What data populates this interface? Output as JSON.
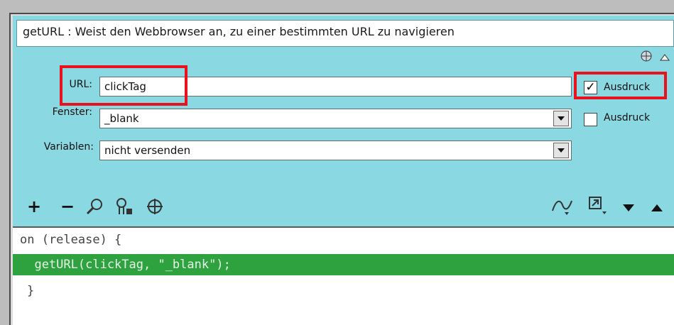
{
  "title": "getURL : Weist den Webbrowser an, zu einer bestimmten URL zu navigieren",
  "top_icons": [
    "globe-icon",
    "collapse-up-icon"
  ],
  "fields": {
    "url": {
      "label": "URL:",
      "value": "clickTag",
      "checkbox_checked": true,
      "checkbox_label": "Ausdruck"
    },
    "fenster": {
      "label": "Fenster:",
      "value": "_blank",
      "checkbox_checked": false,
      "checkbox_label": "Ausdruck"
    },
    "variablen": {
      "label": "Variablen:",
      "value": "nicht versenden"
    }
  },
  "toolbar_left": [
    "add-icon",
    "remove-icon",
    "find-icon",
    "replace-icon",
    "target-icon"
  ],
  "toolbar_right": [
    "script-assist-icon",
    "insert-target-icon",
    "move-down-icon",
    "move-up-icon"
  ],
  "code_lines": [
    {
      "text": "on (release) {",
      "highlighted": false
    },
    {
      "text": "  getURL(clickTag, \"_blank\");",
      "highlighted": true
    },
    {
      "text": "}",
      "highlighted": false
    }
  ],
  "colors": {
    "panel": "#89d8e2",
    "highlight": "#2da23f",
    "annotation": "#e8121e"
  }
}
